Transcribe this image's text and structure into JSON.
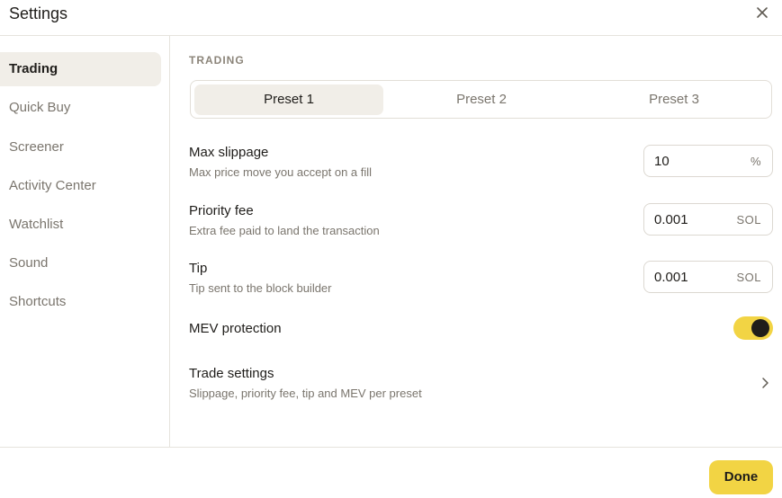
{
  "header": {
    "title": "Settings",
    "close_icon": "close-icon"
  },
  "sidebar": {
    "items": [
      {
        "label": "Trading",
        "active": true
      },
      {
        "label": "Quick Buy",
        "active": false
      },
      {
        "label": "Screener",
        "active": false
      },
      {
        "label": "Activity Center",
        "active": false
      },
      {
        "label": "Watchlist",
        "active": false
      },
      {
        "label": "Sound",
        "active": false
      },
      {
        "label": "Shortcuts",
        "active": false
      }
    ]
  },
  "main": {
    "section_label": "TRADING",
    "tabs": [
      {
        "label": "Preset 1",
        "active": true
      },
      {
        "label": "Preset 2",
        "active": false
      },
      {
        "label": "Preset 3",
        "active": false
      }
    ],
    "settings": {
      "max_slippage": {
        "title": "Max slippage",
        "description": "Max price move you accept on a fill",
        "value": "10",
        "unit": "%"
      },
      "priority_fee": {
        "title": "Priority fee",
        "description": "Extra fee paid to land the transaction",
        "value": "0.001",
        "unit": "SOL"
      },
      "tip": {
        "title": "Tip",
        "description": "Tip sent to the block builder",
        "value": "0.001",
        "unit": "SOL"
      },
      "mev_protection": {
        "title": "MEV protection",
        "enabled": true
      },
      "trade_settings": {
        "title": "Trade settings",
        "description": "Slippage, priority fee, tip and MEV per preset",
        "icon": "chevron-right-icon"
      }
    }
  },
  "footer": {
    "done_label": "Done"
  },
  "colors": {
    "accent": "#f2d444",
    "active_bg": "#f1eee8",
    "text_primary": "#1f1d1a",
    "text_secondary": "#7a756d",
    "border": "#e6e3dd"
  }
}
